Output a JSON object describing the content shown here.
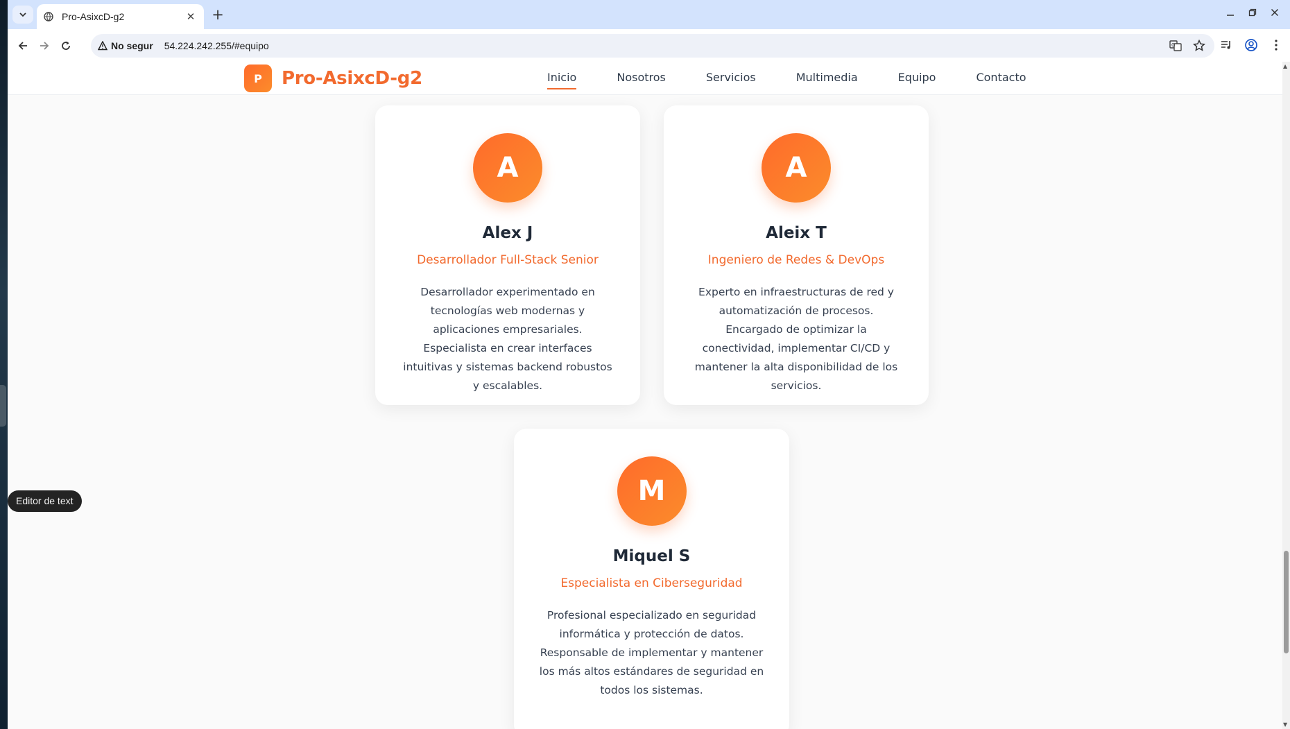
{
  "browser": {
    "tab_title": "Pro-AsixcD-g2",
    "security_label": "No segur",
    "url": "54.224.242.255/#equipo"
  },
  "site": {
    "logo_letter": "P",
    "brand_name": "Pro-AsixcD-g2",
    "nav": [
      "Inicio",
      "Nosotros",
      "Servicios",
      "Multimedia",
      "Equipo",
      "Contacto"
    ],
    "active_nav": "Inicio",
    "accent_color": "#f26a2e"
  },
  "team": [
    {
      "initial": "A",
      "name": "Alex J",
      "role": "Desarrollador Full-Stack Senior",
      "bio": "Desarrollador experimentado en tecnologías web modernas y aplicaciones empresariales. Especialista en crear interfaces intuitivas y sistemas backend robustos y escalables."
    },
    {
      "initial": "A",
      "name": "Aleix T",
      "role": "Ingeniero de Redes & DevOps",
      "bio": "Experto en infraestructuras de red y automatización de procesos. Encargado de optimizar la conectividad, implementar CI/CD y mantener la alta disponibilidad de los servicios."
    },
    {
      "initial": "M",
      "name": "Miquel S",
      "role": "Especialista en Ciberseguridad",
      "bio": "Profesional especializado en seguridad informática y protección de datos. Responsable de implementar y mantener los más altos estándares de seguridad en todos los sistemas."
    }
  ],
  "desktop": {
    "tooltip": "Editor de text"
  }
}
